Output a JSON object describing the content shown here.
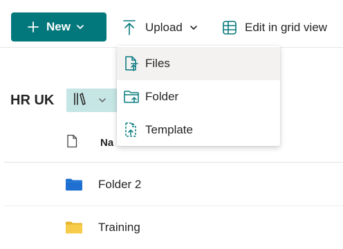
{
  "toolbar": {
    "new_label": "New",
    "upload_label": "Upload",
    "edit_grid_label": "Edit in grid view"
  },
  "library": {
    "title": "HR UK"
  },
  "list_header": {
    "name_column": "Na"
  },
  "rows": [
    {
      "name": "Folder 2",
      "icon": "folder-blue-icon"
    },
    {
      "name": "Training",
      "icon": "folder-yellow-icon"
    }
  ],
  "upload_menu": {
    "items": [
      {
        "label": "Files",
        "icon": "file-upload-icon"
      },
      {
        "label": "Folder",
        "icon": "folder-upload-icon"
      },
      {
        "label": "Template",
        "icon": "template-upload-icon"
      }
    ]
  },
  "colors": {
    "accent": "#03787c",
    "view_switch_bg": "#c6e5e5",
    "folder_blue": "#1e6fcf",
    "folder_yellow": "#f4c430",
    "menu_hover": "#f3f2f1"
  }
}
